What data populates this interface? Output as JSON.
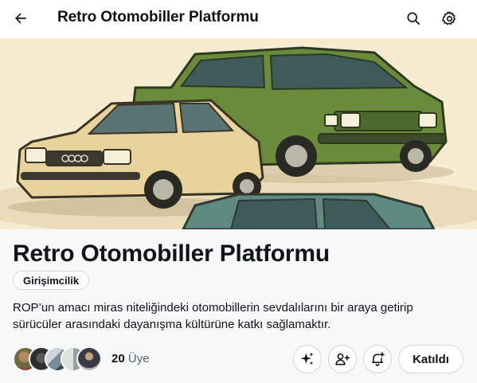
{
  "header": {
    "title": "Retro Otomobiller Platformu",
    "back_icon": "arrow-left-icon",
    "search_icon": "search-icon",
    "settings_icon": "gear-icon"
  },
  "banner": {
    "image": "illustration of three retro cars: beige sedan, green sedan, teal car"
  },
  "community": {
    "name": "Retro Otomobiller Platformu",
    "category": "Girişimcilik",
    "description": "ROP’un amacı miras niteliğindeki otomobillerin sevdalılarını bir araya getirip sürücüler arasındaki dayanışma kültürüne katkı sağlamaktır.",
    "member_count": "20",
    "member_label": "Üye",
    "join_label": "Katıldı"
  },
  "actions": {
    "sparkle_icon": "sparkle-icon",
    "add_user_icon": "add-user-icon",
    "bell_icon": "bell-plus-icon"
  },
  "colors": {
    "accent_text": "#0f1419",
    "secondary_text": "#536471",
    "border": "#cfd9de",
    "info_background": "#f7f9f9"
  }
}
